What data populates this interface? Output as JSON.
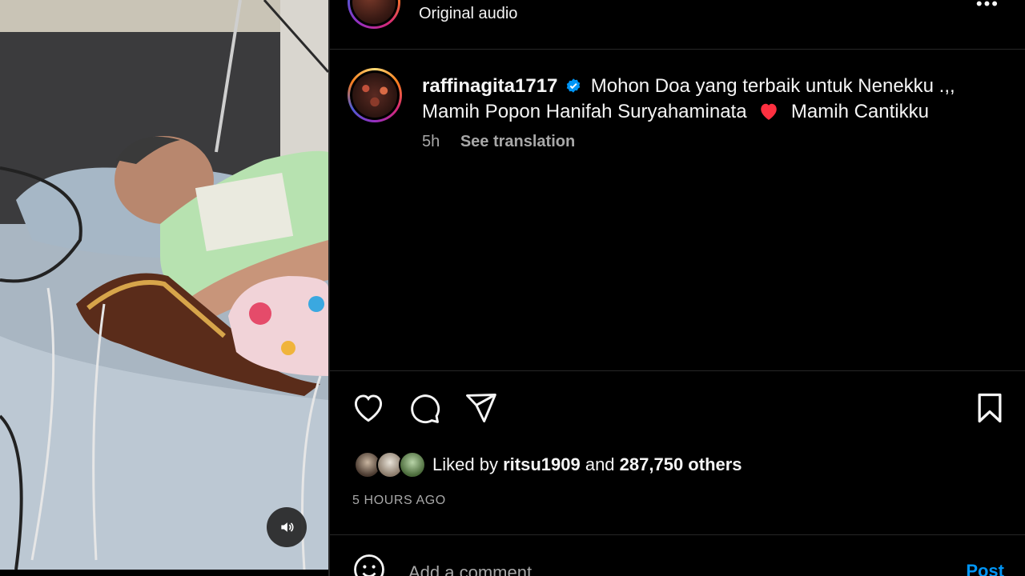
{
  "media": {
    "type": "video",
    "mute_icon": "volume-icon"
  },
  "audio": {
    "label": "Original audio",
    "more_icon": "more-horizontal-icon"
  },
  "post": {
    "username": "raffinagita1717",
    "verified": true,
    "caption_part1": "Mohon Doa yang terbaik untuk Nenekku .,, Mamih Popon Hanifah Suryahaminata",
    "caption_part2": "Mamih Cantikku",
    "caption_emoji": "red-heart",
    "time_ago": "5h",
    "translate_label": "See translation"
  },
  "actions": {
    "like_icon": "heart-icon",
    "comment_icon": "comment-icon",
    "share_icon": "send-icon",
    "save_icon": "bookmark-icon"
  },
  "likes": {
    "prefix": "Liked by",
    "user": "ritsu1909",
    "connector": "and",
    "others": "287,750 others"
  },
  "timestamp": "5 HOURS AGO",
  "comment": {
    "placeholder": "Add a comment...",
    "post_label": "Post",
    "emoji_icon": "emoji-icon"
  },
  "colors": {
    "background": "#000000",
    "text": "#f5f5f5",
    "secondary": "#a8a8a8",
    "accent": "#0095f6",
    "heart": "#ff3040",
    "verified": "#0095f6"
  }
}
